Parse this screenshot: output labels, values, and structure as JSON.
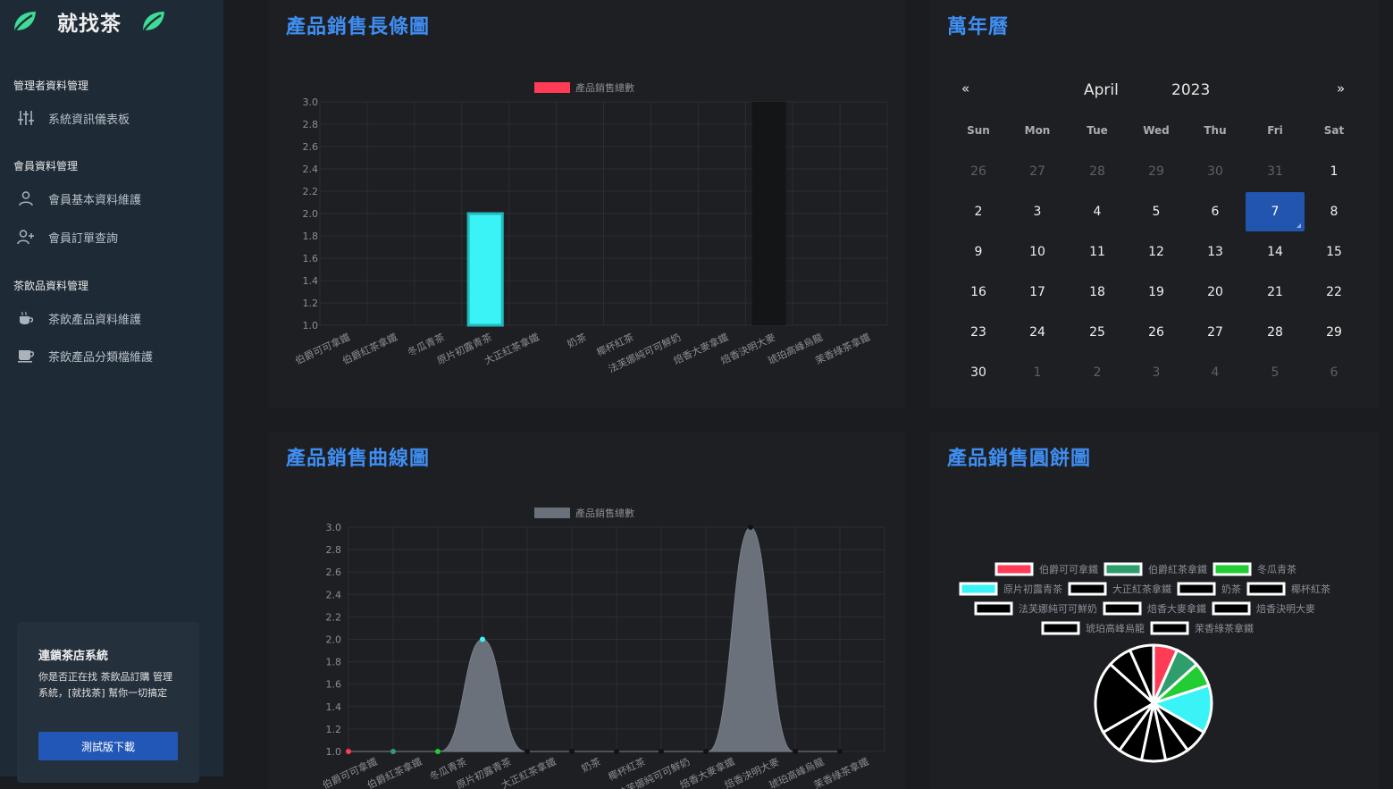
{
  "sidebar": {
    "brand": "就找茶",
    "sections": [
      {
        "title": "管理者資料管理",
        "items": [
          {
            "label": "系統資訊儀表板",
            "icon": "sliders-icon"
          }
        ]
      },
      {
        "title": "會員資料管理",
        "items": [
          {
            "label": "會員基本資料維護",
            "icon": "user-icon"
          },
          {
            "label": "會員訂單查詢",
            "icon": "user-plus-icon"
          }
        ]
      },
      {
        "title": "茶飲品資料管理",
        "items": [
          {
            "label": "茶飲產品資料維護",
            "icon": "cup-icon"
          },
          {
            "label": "茶飲產品分類檔維護",
            "icon": "mug-icon"
          }
        ]
      }
    ],
    "promo": {
      "title": "連鎖茶店系統",
      "text": "你是否正在找 茶飲品訂購 管理系統，[就找茶] 幫你一切搞定",
      "button": "測試版下載"
    }
  },
  "bar_card": {
    "title": "產品銷售長條圖"
  },
  "line_card": {
    "title": "產品銷售曲線圖"
  },
  "pie_card": {
    "title": "產品銷售圓餅圖"
  },
  "calendar": {
    "title": "萬年曆",
    "prev": "«",
    "next": "»",
    "month": "April",
    "year": "2023",
    "weekdays": [
      "Sun",
      "Mon",
      "Tue",
      "Wed",
      "Thu",
      "Fri",
      "Sat"
    ],
    "weeks": [
      [
        "26",
        "27",
        "28",
        "29",
        "30",
        "31",
        "1"
      ],
      [
        "2",
        "3",
        "4",
        "5",
        "6",
        "7",
        "8"
      ],
      [
        "9",
        "10",
        "11",
        "12",
        "13",
        "14",
        "15"
      ],
      [
        "16",
        "17",
        "18",
        "19",
        "20",
        "21",
        "22"
      ],
      [
        "23",
        "24",
        "25",
        "26",
        "27",
        "28",
        "29"
      ],
      [
        "30",
        "1",
        "2",
        "3",
        "4",
        "5",
        "6"
      ]
    ],
    "selected": "7"
  },
  "chart_data": [
    {
      "type": "bar",
      "title": "",
      "legend": [
        "產品銷售總數"
      ],
      "categories": [
        "伯爵可可拿鐵",
        "伯爵紅茶拿鐵",
        "冬瓜青茶",
        "原片初露青茶",
        "大正紅茶拿鐵",
        "奶茶",
        "椰杯紅茶",
        "法芙娜純可可鮮奶",
        "焙香大麥拿鐵",
        "焙香決明大麥",
        "琥珀高峰烏龍",
        "茉香綠茶拿鐵"
      ],
      "series": [
        {
          "name": "產品銷售總數",
          "values": [
            1,
            1,
            1,
            2,
            1,
            1,
            1,
            1,
            1,
            3,
            1,
            1
          ]
        }
      ],
      "ylim": [
        1.0,
        3.0
      ],
      "yticks": [
        "1.0",
        "1.2",
        "1.4",
        "1.6",
        "1.8",
        "2.0",
        "2.2",
        "2.4",
        "2.6",
        "2.8",
        "3.0"
      ],
      "colors": [
        "#ff3b55",
        "#2e9e6c",
        "#22cc33",
        "#39f3f6",
        "#1c1d22",
        "#1c1d22",
        "#1c1d22",
        "#1c1d22",
        "#1c1d22",
        "#141517",
        "#1c1d22",
        "#1c1d22"
      ],
      "grid": true,
      "legend_position": "top"
    },
    {
      "type": "line",
      "title": "",
      "legend": [
        "產品銷售總數"
      ],
      "categories": [
        "伯爵可可拿鐵",
        "伯爵紅茶拿鐵",
        "冬瓜青茶",
        "原片初露青茶",
        "大正紅茶拿鐵",
        "奶茶",
        "椰杯紅茶",
        "法芙娜純可可鮮奶",
        "焙香大麥拿鐵",
        "焙香決明大麥",
        "琥珀高峰烏龍",
        "茉香綠茶拿鐵"
      ],
      "series": [
        {
          "name": "產品銷售總數",
          "values": [
            1,
            1,
            1,
            2,
            1,
            1,
            1,
            1,
            1,
            3,
            1,
            1
          ]
        }
      ],
      "ylim": [
        1.0,
        3.0
      ],
      "yticks": [
        "1.0",
        "1.2",
        "1.4",
        "1.6",
        "1.8",
        "2.0",
        "2.2",
        "2.4",
        "2.6",
        "2.8",
        "3.0"
      ],
      "fill": "#6b717b",
      "grid": true,
      "legend_position": "top"
    },
    {
      "type": "pie",
      "title": "",
      "labels": [
        "伯爵可可拿鐵",
        "伯爵紅茶拿鐵",
        "冬瓜青茶",
        "原片初露青茶",
        "大正紅茶拿鐵",
        "奶茶",
        "椰杯紅茶",
        "法芙娜純可可鮮奶",
        "焙香大麥拿鐵",
        "焙香決明大麥",
        "琥珀高峰烏龍",
        "茉香綠茶拿鐵"
      ],
      "values": [
        1,
        1,
        1,
        2,
        1,
        1,
        1,
        1,
        1,
        3,
        1,
        1
      ],
      "colors": [
        "#ff3b55",
        "#2e9e6c",
        "#22cc33",
        "#39f3f6",
        "#000000",
        "#000000",
        "#000000",
        "#000000",
        "#000000",
        "#000000",
        "#000000",
        "#000000"
      ],
      "legend_position": "top"
    }
  ]
}
